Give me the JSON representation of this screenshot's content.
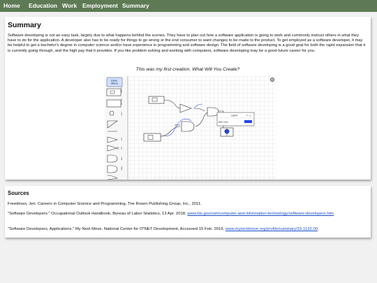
{
  "nav": {
    "items": [
      "Home",
      "Education",
      "Work",
      "Employment",
      "Summary"
    ]
  },
  "summary": {
    "heading": "Summary",
    "paragraph": "Software developing is not an easy task, largely due to what happens behind the scenes. They have to plan out how a software application is going to work and commonly instruct others in what they have to do for the application. A developer also has to be ready for things to go wrong or the end consumer to want changes to be made to the product. To get employed as a software developer, it may be helpful to get a bachelor's degree in computer science and/or have experience in programming and software design. The field of software developing is a good goal for both the rapid expansion that it is currently going through, and the high pay that it provides. If you like problem solving and working with computers, software developing may be a good future career for you.",
    "caption": "This was my first creation. What Will You Create?"
  },
  "simulator": {
    "clear_menu_label": "Clear\nMenu",
    "gear_icon": "gear-icon",
    "light_label": "LIGHT",
    "bulb_color_label": "Bulb Color",
    "help_glyph": "?",
    "close_glyph": "×",
    "accent_color": "#2244ee"
  },
  "sources": {
    "heading": "Sources",
    "items": [
      {
        "text": "Freedman, Jeri. Careers in Computer Science and Programming, The Rosen Publishing Group, Inc., 2011.",
        "link": ""
      },
      {
        "text": "\"Software Developers.\" Occupational Outlook Handbook, Bureau of Labor Statistics, 13 Apr. 2018, ",
        "link": "www.bls.gov/ooh/computer-and-information-technology/software-developers.htm",
        "tail": "."
      },
      {
        "text": "\"Software Developers, Applications.\" My Next Move, National Center for O*NET Development, Accessed 15 Feb. 2019, ",
        "link": "www.mynextmove.org/profile/summary/15-1132.00",
        "tail": "."
      }
    ]
  }
}
